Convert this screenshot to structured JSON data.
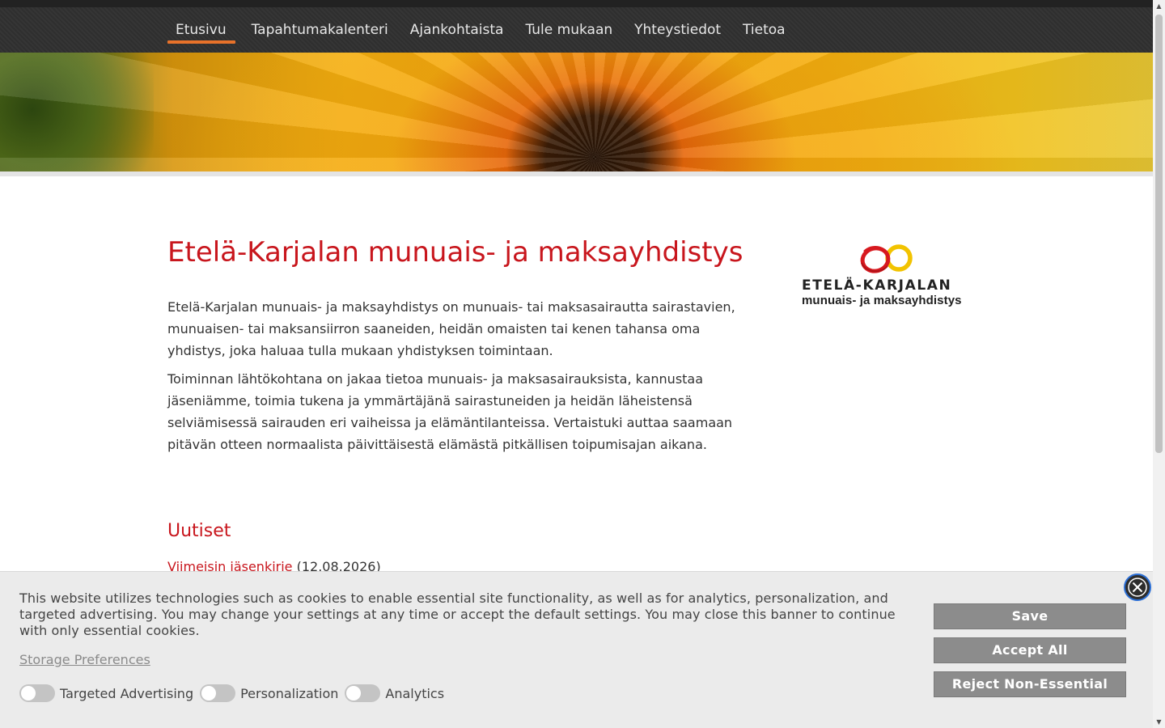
{
  "nav": {
    "items": [
      {
        "label": "Etusivu",
        "active": true
      },
      {
        "label": "Tapahtumakalenteri"
      },
      {
        "label": "Ajankohtaista"
      },
      {
        "label": "Tule mukaan"
      },
      {
        "label": "Yhteystiedot"
      },
      {
        "label": "Tietoa"
      }
    ]
  },
  "main": {
    "title": "Etelä-Karjalan munuais- ja maksayhdistys",
    "paragraphs": [
      "Etelä-Karjalan munuais- ja maksayhdistys on munuais- tai maksasairautta sairastavien, munuaisen- tai maksansiirron saaneiden, heidän omaisten tai kenen tahansa oma yhdistys, joka haluaa tulla mukaan yhdistyksen toimintaan.",
      "Toiminnan lähtökohtana on jakaa tietoa munuais- ja maksasairauksista, kannustaa jäseniämme, toimia tukena ja ymmärtäjänä sairastuneiden ja heidän läheistensä selviämisessä sairauden eri vaiheissa ja elämäntilanteissa. Vertaistuki auttaa saamaan pitävän otteen normaalista päivittäisestä elämästä pitkällisen toipumisajan aikana."
    ],
    "news_heading": "Uutiset",
    "news_link": "Viimeisin jäsenkirje",
    "news_date": "(12.08.2026)"
  },
  "logo": {
    "line1": "ETELÄ-KARJALAN",
    "line2": "munuais- ja maksayhdistys",
    "colors": {
      "red": "#d7191f",
      "yellow": "#f2c300"
    }
  },
  "cookie_banner": {
    "text": "This website utilizes technologies such as cookies to enable essential site functionality, as well as for analytics, personalization, and targeted advertising. You may change your settings at any time or accept the default settings. You may close this banner to continue with only essential cookies.",
    "preferences_link": "Storage Preferences",
    "toggles": [
      {
        "label": "Targeted Advertising",
        "on": false
      },
      {
        "label": "Personalization",
        "on": false
      },
      {
        "label": "Analytics",
        "on": false
      }
    ],
    "buttons": {
      "save": "Save",
      "accept": "Accept All",
      "reject": "Reject Non-Essential"
    },
    "close_icon": "close-icon"
  },
  "colors": {
    "accent": "#c8161d",
    "nav_active": "#e8722a",
    "nav_bg": "#2f2f2f"
  }
}
